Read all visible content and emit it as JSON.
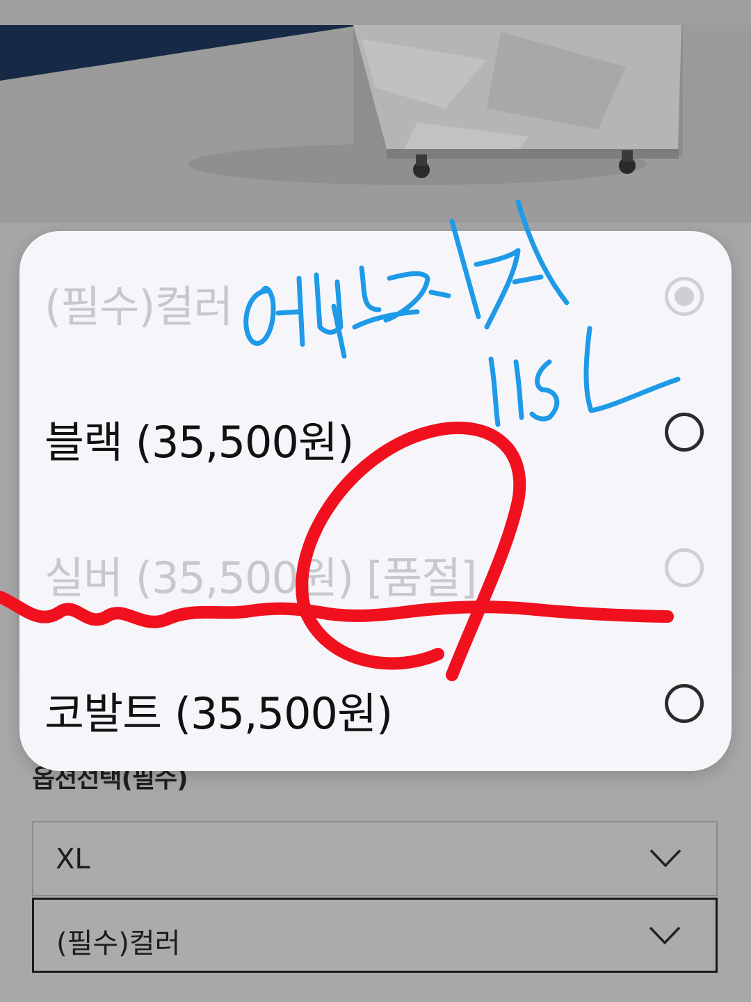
{
  "colors": {
    "dialog_bg": "#f6f6fa",
    "scrim": "#a9a9a9",
    "required_mark": "#b3201a",
    "annotation_blue": "#1e9ae8",
    "annotation_red": "#f0101e"
  },
  "product_image": {
    "icon": "cart-cover-photo"
  },
  "option_dialog": {
    "title": "(필수)컬러",
    "options": [
      {
        "label": "블랙 (35,500원)",
        "available": true,
        "selected": false
      },
      {
        "label": "실버 (35,500원) [품절]",
        "available": false,
        "selected": false
      },
      {
        "label": "코발트 (35,500원)",
        "available": true,
        "selected": false
      }
    ]
  },
  "option_section": {
    "label": "옵션선택(필수)",
    "required_mark": "*",
    "size_select": {
      "value": "XL",
      "icon": "chevron-down-icon"
    },
    "color_select": {
      "value": "(필수)컬러",
      "icon": "chevron-down-icon"
    }
  },
  "handwriting": {
    "blue_text_line1": "엑스라지",
    "blue_text_line2": "115L"
  }
}
